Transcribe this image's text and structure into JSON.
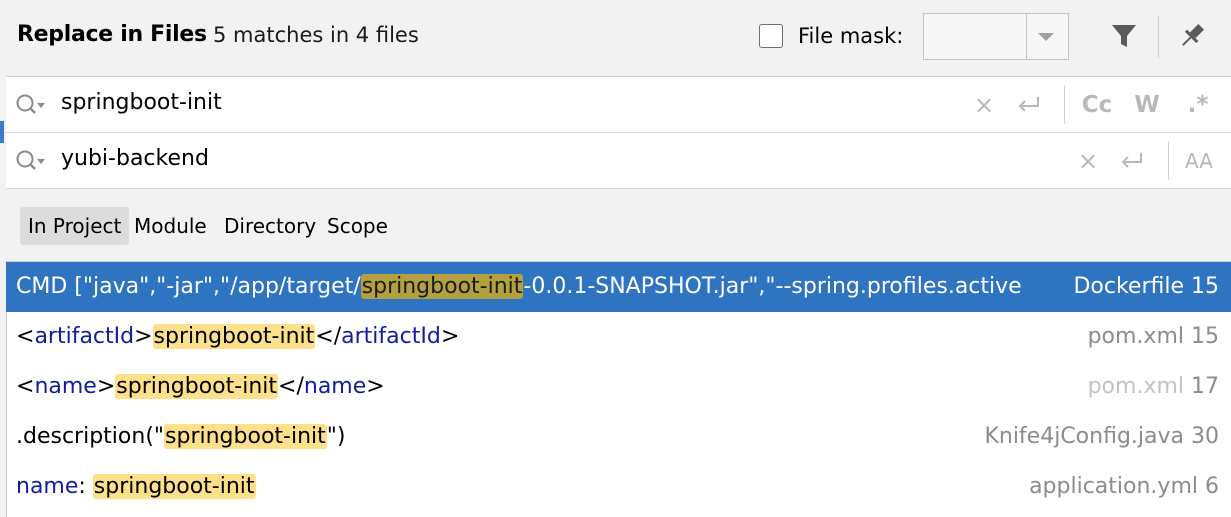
{
  "header": {
    "title": "Replace in Files",
    "match_count": "5 matches in 4 files",
    "file_mask_label": "File mask:",
    "file_mask_value": ""
  },
  "search": {
    "find_value": "springboot-init",
    "replace_value": "yubi-backend",
    "match_case_label": "Cc",
    "whole_words_label": "W",
    "regex_label": ".*",
    "preserve_case_label": "AA"
  },
  "scope": {
    "tabs": [
      {
        "label": "In Project",
        "selected": true
      },
      {
        "label": "Module"
      },
      {
        "label": "Directory"
      },
      {
        "label": "Scope"
      }
    ]
  },
  "results": [
    {
      "pre": "CMD [\"java\",\"-jar\",\"/app/target/",
      "match": "springboot-init",
      "post": "-0.0.1-SNAPSHOT.jar\",\"--spring.profiles.active",
      "file": "Dockerfile",
      "line": "15"
    },
    {
      "pre_open": "<",
      "pre_tag": "artifactId",
      "pre_close": ">",
      "match": "springboot-init",
      "post_open": "</",
      "post_tag": "artifactId",
      "post_close": ">",
      "file": "pom.xml",
      "line": "15"
    },
    {
      "pre_open": "<",
      "pre_tag": "name",
      "pre_close": ">",
      "match": "springboot-init",
      "post_open": "</",
      "post_tag": "name",
      "post_close": ">",
      "file": "pom.xml",
      "line": "17"
    },
    {
      "pre": ".description(\"",
      "match": "springboot-init",
      "post": "\")",
      "file": "Knife4jConfig.java",
      "line": "30"
    },
    {
      "key": "name",
      "colon": ": ",
      "match": "springboot-init",
      "file": "application.yml",
      "line": "6"
    }
  ],
  "colors": {
    "selection": "#2f74c0",
    "highlight": "#fde08a",
    "selected_highlight": "#b3a13f"
  }
}
